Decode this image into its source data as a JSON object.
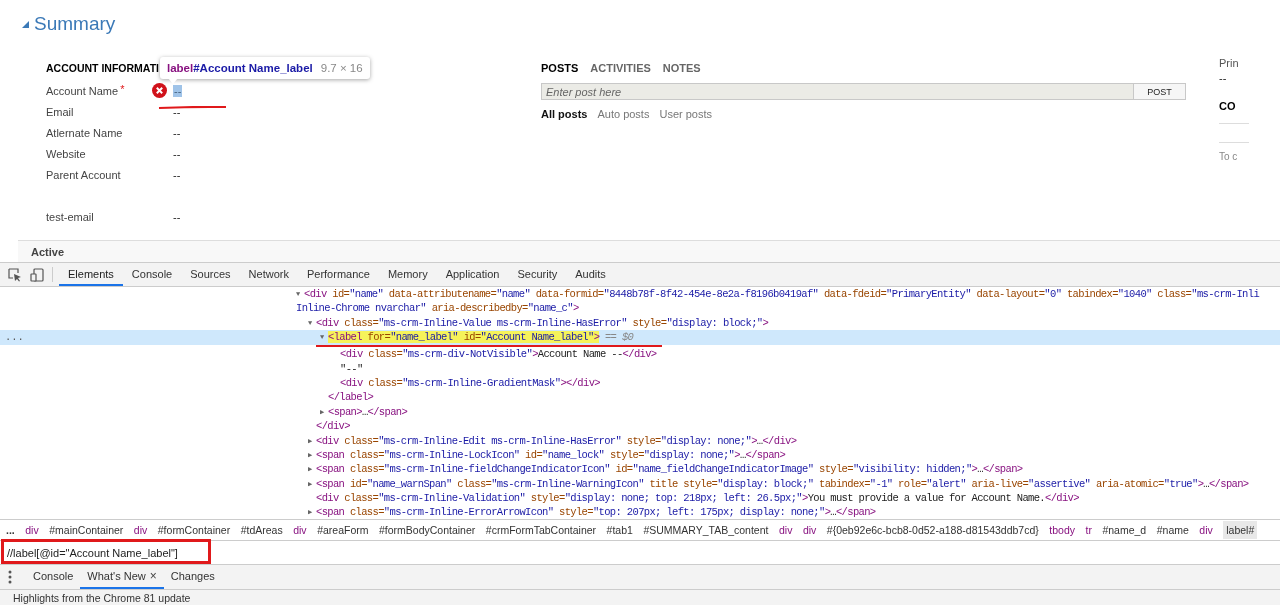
{
  "summary": {
    "title": "Summary"
  },
  "account_information": {
    "heading": "ACCOUNT INFORMATI",
    "fields": [
      {
        "label": "Account Name",
        "required_mark": "*",
        "error": true,
        "inspected": true,
        "value": "--"
      },
      {
        "label": "Email",
        "error": false,
        "inspected": false,
        "value": "--"
      },
      {
        "label": "Atlernate Name",
        "error": false,
        "inspected": false,
        "value": "--"
      },
      {
        "label": "Website",
        "error": false,
        "inspected": false,
        "value": "--"
      },
      {
        "label": "Parent Account",
        "error": false,
        "inspected": false,
        "value": "--"
      },
      {
        "label": "test-email",
        "error": false,
        "inspected": false,
        "value": "--",
        "spaced": true
      }
    ]
  },
  "social_pane": {
    "tabs": [
      {
        "label": "POSTS",
        "selected": true
      },
      {
        "label": "ACTIVITIES",
        "selected": false
      },
      {
        "label": "NOTES",
        "selected": false
      }
    ],
    "post_field": {
      "placeholder": "Enter post here"
    },
    "post_button": "POST",
    "filters": [
      {
        "label": "All posts",
        "selected": true
      },
      {
        "label": "Auto posts",
        "selected": false
      },
      {
        "label": "User posts",
        "selected": false
      }
    ]
  },
  "right_column": {
    "label": "Prin",
    "value": "--",
    "heading": "CO",
    "text": "To c"
  },
  "inspect_tooltip": {
    "tag": "label",
    "id": "#Account Name_label",
    "size": "9.7 × 16"
  },
  "status_bar": {
    "text": "Active"
  },
  "devtools": {
    "tabs": [
      {
        "label": "Elements",
        "selected": true
      },
      {
        "label": "Console",
        "selected": false
      },
      {
        "label": "Sources",
        "selected": false
      },
      {
        "label": "Network",
        "selected": false
      },
      {
        "label": "Performance",
        "selected": false
      },
      {
        "label": "Memory",
        "selected": false
      },
      {
        "label": "Application",
        "selected": false
      },
      {
        "label": "Security",
        "selected": false
      },
      {
        "label": "Audits",
        "selected": false
      }
    ],
    "dom_tree": [
      {
        "toggle": "▼",
        "selected": false,
        "match": false,
        "segments": [
          {
            "kind": "tag",
            "text": "<div"
          },
          {
            "kind": "attr",
            "text": " id="
          },
          {
            "kind": "value",
            "text": "\"name\""
          },
          {
            "kind": "attr",
            "text": " data-attributename="
          },
          {
            "kind": "value",
            "text": "\"name\""
          },
          {
            "kind": "attr",
            "text": " data-formid="
          },
          {
            "kind": "value",
            "text": "\"8448b78f-8f42-454e-8e2a-f8196b0419af\""
          },
          {
            "kind": "attr",
            "text": " data-fdeid="
          },
          {
            "kind": "value",
            "text": "\"PrimaryEntity\""
          },
          {
            "kind": "attr",
            "text": " data-layout="
          },
          {
            "kind": "value",
            "text": "\"0\""
          },
          {
            "kind": "attr",
            "text": " tabindex="
          },
          {
            "kind": "value",
            "text": "\"1040\""
          },
          {
            "kind": "attr",
            "text": " class="
          },
          {
            "kind": "value",
            "text": "\"ms-crm-Inli"
          }
        ],
        "wrapped_segments": [
          {
            "kind": "value",
            "text": "Inline-Chrome nvarchar\""
          },
          {
            "kind": "attr",
            "text": " aria-describedby="
          },
          {
            "kind": "value",
            "text": "\"name_c\""
          },
          {
            "kind": "tag",
            "text": ">"
          }
        ],
        "children": [
          {
            "toggle": "▼",
            "selected": false,
            "match": false,
            "segments": [
              {
                "kind": "tag",
                "text": "<div"
              },
              {
                "kind": "attr",
                "text": " class="
              },
              {
                "kind": "value",
                "text": "\"ms-crm-Inline-Value ms-crm-Inline-HasError\""
              },
              {
                "kind": "attr",
                "text": " style="
              },
              {
                "kind": "value",
                "text": "\"display: block;\""
              },
              {
                "kind": "tag",
                "text": ">"
              }
            ],
            "children": [
              {
                "toggle": "▼",
                "selected": true,
                "match": true,
                "gutter": "...",
                "segments": [
                  {
                    "kind": "tag",
                    "text": "<label"
                  },
                  {
                    "kind": "attr",
                    "text": " for="
                  },
                  {
                    "kind": "value",
                    "text": "\"name_label\""
                  },
                  {
                    "kind": "attr",
                    "text": " id="
                  },
                  {
                    "kind": "value",
                    "text": "\"Account Name_label\""
                  },
                  {
                    "kind": "tag",
                    "text": ">"
                  },
                  {
                    "kind": "ref",
                    "text": " == $0"
                  }
                ],
                "children": [
                  {
                    "selected": false,
                    "match": false,
                    "segments": [
                      {
                        "kind": "tag",
                        "text": "<div"
                      },
                      {
                        "kind": "attr",
                        "text": " class="
                      },
                      {
                        "kind": "value",
                        "text": "\"ms-crm-div-NotVisible\""
                      },
                      {
                        "kind": "tag",
                        "text": ">"
                      },
                      {
                        "kind": "text",
                        "text": "Account Name --"
                      },
                      {
                        "kind": "tag",
                        "text": "</div>"
                      }
                    ]
                  },
                  {
                    "selected": false,
                    "match": false,
                    "segments": [
                      {
                        "kind": "text",
                        "text": "\"--\""
                      }
                    ]
                  },
                  {
                    "selected": false,
                    "match": false,
                    "segments": [
                      {
                        "kind": "tag",
                        "text": "<div"
                      },
                      {
                        "kind": "attr",
                        "text": " class="
                      },
                      {
                        "kind": "value",
                        "text": "\"ms-crm-Inline-GradientMask\""
                      },
                      {
                        "kind": "tag",
                        "text": "></div>"
                      }
                    ]
                  }
                ]
              },
              {
                "selected": false,
                "match": false,
                "segments": [
                  {
                    "kind": "tag",
                    "text": "</label>"
                  }
                ]
              },
              {
                "toggle": "▶",
                "selected": false,
                "match": false,
                "segments": [
                  {
                    "kind": "tag",
                    "text": "<span>"
                  },
                  {
                    "kind": "text",
                    "text": "…"
                  },
                  {
                    "kind": "tag",
                    "text": "</span>"
                  }
                ]
              }
            ]
          },
          {
            "selected": false,
            "match": false,
            "segments": [
              {
                "kind": "tag",
                "text": "</div>"
              }
            ]
          },
          {
            "toggle": "▶",
            "selected": false,
            "match": false,
            "segments": [
              {
                "kind": "tag",
                "text": "<div"
              },
              {
                "kind": "attr",
                "text": " class="
              },
              {
                "kind": "value",
                "text": "\"ms-crm-Inline-Edit ms-crm-Inline-HasError\""
              },
              {
                "kind": "attr",
                "text": " style="
              },
              {
                "kind": "value",
                "text": "\"display: none;\""
              },
              {
                "kind": "tag",
                "text": ">"
              },
              {
                "kind": "text",
                "text": "…"
              },
              {
                "kind": "tag",
                "text": "</div>"
              }
            ]
          },
          {
            "toggle": "▶",
            "selected": false,
            "match": false,
            "segments": [
              {
                "kind": "tag",
                "text": "<span"
              },
              {
                "kind": "attr",
                "text": " class="
              },
              {
                "kind": "value",
                "text": "\"ms-crm-Inline-LockIcon\""
              },
              {
                "kind": "attr",
                "text": " id="
              },
              {
                "kind": "value",
                "text": "\"name_lock\""
              },
              {
                "kind": "attr",
                "text": " style="
              },
              {
                "kind": "value",
                "text": "\"display: none;\""
              },
              {
                "kind": "tag",
                "text": ">"
              },
              {
                "kind": "text",
                "text": "…"
              },
              {
                "kind": "tag",
                "text": "</span>"
              }
            ]
          },
          {
            "toggle": "▶",
            "selected": false,
            "match": false,
            "segments": [
              {
                "kind": "tag",
                "text": "<span"
              },
              {
                "kind": "attr",
                "text": " class="
              },
              {
                "kind": "value",
                "text": "\"ms-crm-Inline-fieldChangeIndicatorIcon\""
              },
              {
                "kind": "attr",
                "text": " id="
              },
              {
                "kind": "value",
                "text": "\"name_fieldChangeIndicatorImage\""
              },
              {
                "kind": "attr",
                "text": " style="
              },
              {
                "kind": "value",
                "text": "\"visibility: hidden;\""
              },
              {
                "kind": "tag",
                "text": ">"
              },
              {
                "kind": "text",
                "text": "…"
              },
              {
                "kind": "tag",
                "text": "</span>"
              }
            ]
          },
          {
            "toggle": "▶",
            "selected": false,
            "match": false,
            "segments": [
              {
                "kind": "tag",
                "text": "<span"
              },
              {
                "kind": "attr",
                "text": " id="
              },
              {
                "kind": "value",
                "text": "\"name_warnSpan\""
              },
              {
                "kind": "attr",
                "text": " class="
              },
              {
                "kind": "value",
                "text": "\"ms-crm-Inline-WarningIcon\""
              },
              {
                "kind": "attr",
                "text": " title"
              },
              {
                "kind": "attr",
                "text": " style="
              },
              {
                "kind": "value",
                "text": "\"display: block;\""
              },
              {
                "kind": "attr",
                "text": " tabindex="
              },
              {
                "kind": "value",
                "text": "\"-1\""
              },
              {
                "kind": "attr",
                "text": " role="
              },
              {
                "kind": "value",
                "text": "\"alert\""
              },
              {
                "kind": "attr",
                "text": " aria-live="
              },
              {
                "kind": "value",
                "text": "\"assertive\""
              },
              {
                "kind": "attr",
                "text": " aria-atomic="
              },
              {
                "kind": "value",
                "text": "\"true\""
              },
              {
                "kind": "tag",
                "text": ">"
              },
              {
                "kind": "text",
                "text": "…"
              },
              {
                "kind": "tag",
                "text": "</span>"
              }
            ]
          },
          {
            "selected": false,
            "match": false,
            "segments": [
              {
                "kind": "tag",
                "text": "<div"
              },
              {
                "kind": "attr",
                "text": " class="
              },
              {
                "kind": "value",
                "text": "\"ms-crm-Inline-Validation\""
              },
              {
                "kind": "attr",
                "text": " style="
              },
              {
                "kind": "value",
                "text": "\"display: none; top: 218px; left: 26.5px;\""
              },
              {
                "kind": "tag",
                "text": ">"
              },
              {
                "kind": "text",
                "text": "You must provide a value for Account Name."
              },
              {
                "kind": "tag",
                "text": "</div>"
              }
            ]
          },
          {
            "toggle": "▶",
            "selected": false,
            "match": false,
            "segments": [
              {
                "kind": "tag",
                "text": "<span"
              },
              {
                "kind": "attr",
                "text": " class="
              },
              {
                "kind": "value",
                "text": "\"ms-crm-Inline-ErrorArrowIcon\""
              },
              {
                "kind": "attr",
                "text": " style="
              },
              {
                "kind": "value",
                "text": "\"top: 207px; left: 175px; display: none;\""
              },
              {
                "kind": "tag",
                "text": ">"
              },
              {
                "kind": "text",
                "text": "…"
              },
              {
                "kind": "tag",
                "text": "</span>"
              }
            ]
          }
        ]
      }
    ],
    "breadcrumbs": [
      {
        "text": "...",
        "kind": "more",
        "selected": false
      },
      {
        "text": "div",
        "kind": "tag",
        "selected": false
      },
      {
        "text": "#mainContainer",
        "kind": "id",
        "selected": false
      },
      {
        "text": "div",
        "kind": "tag",
        "selected": false
      },
      {
        "text": "#formContainer",
        "kind": "id",
        "selected": false
      },
      {
        "text": "#tdAreas",
        "kind": "id",
        "selected": false
      },
      {
        "text": "div",
        "kind": "tag",
        "selected": false
      },
      {
        "text": "#areaForm",
        "kind": "id",
        "selected": false
      },
      {
        "text": "#formBodyContainer",
        "kind": "id",
        "selected": false
      },
      {
        "text": "#crmFormTabContainer",
        "kind": "id",
        "selected": false
      },
      {
        "text": "#tab1",
        "kind": "id",
        "selected": false
      },
      {
        "text": "#SUMMARY_TAB_content",
        "kind": "id",
        "selected": false
      },
      {
        "text": "div",
        "kind": "tag",
        "selected": false
      },
      {
        "text": "div",
        "kind": "tag",
        "selected": false
      },
      {
        "text": "#{0eb92e6c-bcb8-0d52-a188-d81543ddb7cd}",
        "kind": "id",
        "selected": false
      },
      {
        "text": "tbody",
        "kind": "tag",
        "selected": false
      },
      {
        "text": "tr",
        "kind": "tag",
        "selected": false
      },
      {
        "text": "#name_d",
        "kind": "id",
        "selected": false
      },
      {
        "text": "#name",
        "kind": "id",
        "selected": false
      },
      {
        "text": "div",
        "kind": "tag",
        "selected": false
      },
      {
        "text": "label#",
        "kind": "id",
        "selected": true
      }
    ],
    "search": {
      "value": "//label[@id=\"Account Name_label\"]"
    },
    "drawer": {
      "tabs": [
        {
          "label": "Console",
          "selected": false
        },
        {
          "label": "What's New",
          "selected": true,
          "close": "×"
        },
        {
          "label": "Changes",
          "selected": false
        }
      ],
      "content": "Highlights from the Chrome 81 update"
    }
  }
}
